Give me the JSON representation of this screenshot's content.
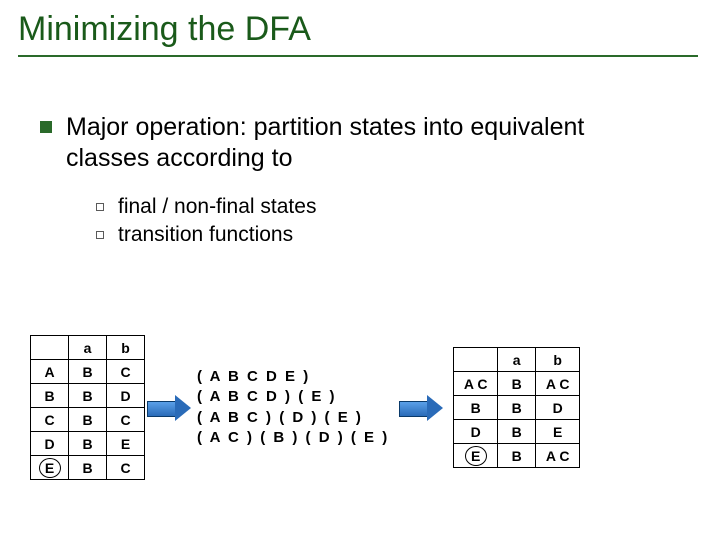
{
  "title": "Minimizing the DFA",
  "main_bullet": "Major operation: partition states into equivalent classes according to",
  "sub_bullets": [
    "final / non-final states",
    "transition functions"
  ],
  "table1": {
    "headers": [
      "",
      "a",
      "b"
    ],
    "rows": [
      [
        "A",
        "B",
        "C"
      ],
      [
        "B",
        "B",
        "D"
      ],
      [
        "C",
        "B",
        "C"
      ],
      [
        "D",
        "B",
        "E"
      ],
      [
        "E",
        "B",
        "C"
      ]
    ],
    "final_marker_row": 4
  },
  "partitions_lines": [
    "( A B C D E )",
    "( A B C D ) ( E )",
    "( A B C ) ( D ) ( E )",
    "( A C ) ( B ) ( D ) ( E )"
  ],
  "table2": {
    "headers": [
      "",
      "a",
      "b"
    ],
    "rows": [
      [
        "A C",
        "B",
        "A C"
      ],
      [
        "B",
        "B",
        "D"
      ],
      [
        "D",
        "B",
        "E"
      ],
      [
        "E",
        "B",
        "A C"
      ]
    ],
    "final_marker_row": 3
  }
}
